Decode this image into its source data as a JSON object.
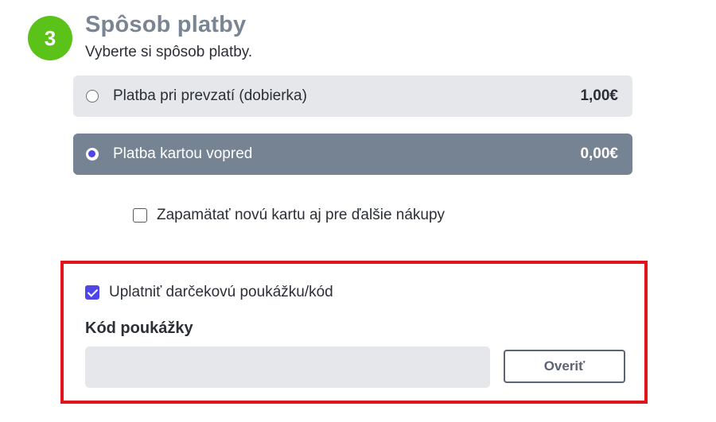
{
  "step": {
    "number": "3",
    "title": "Spôsob platby",
    "subtitle": "Vyberte si spôsob platby."
  },
  "payment_options": [
    {
      "label": "Platba pri prevzatí (dobierka)",
      "price": "1,00€",
      "selected": false
    },
    {
      "label": "Platba kartou vopred",
      "price": "0,00€",
      "selected": true
    }
  ],
  "remember_card": {
    "label": "Zapamätať novú kartu aj pre ďalšie nákupy",
    "checked": false
  },
  "voucher": {
    "apply_label": "Uplatniť darčekovú poukážku/kód",
    "apply_checked": true,
    "code_label": "Kód poukážky",
    "code_value": "",
    "verify_label": "Overiť"
  },
  "colors": {
    "step_badge": "#5bc21a",
    "selected_option_bg": "#768393",
    "unselected_option_bg": "#e5e7ea",
    "highlight_border": "#e1141c",
    "accent": "#4f46e5"
  }
}
